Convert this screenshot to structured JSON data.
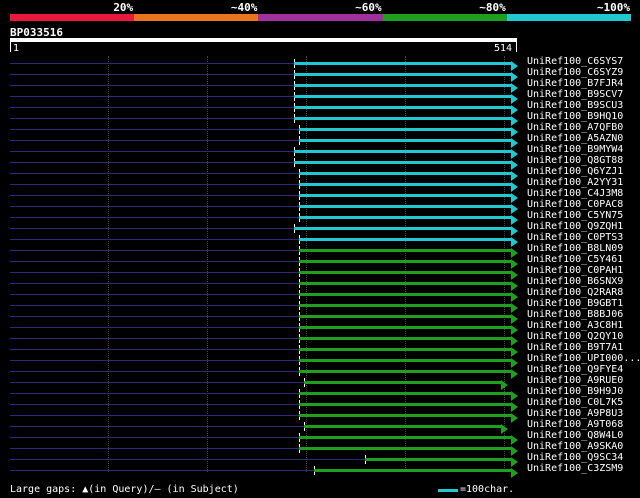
{
  "scale": {
    "segments": [
      {
        "label": "20%",
        "color": "#e8193c"
      },
      {
        "label": "~40%",
        "color": "#e8741e"
      },
      {
        "label": "~60%",
        "color": "#a0309c"
      },
      {
        "label": "~80%",
        "color": "#1ea01e"
      },
      {
        "label": "~100%",
        "color": "#22c8d0"
      }
    ]
  },
  "query": {
    "id": "BP033516",
    "start": "1",
    "end": "514",
    "length": 514
  },
  "hits": [
    {
      "label": "UniRef100_C6SYS7",
      "start": 0.56,
      "end": 1.0,
      "color": "#22c8d0"
    },
    {
      "label": "UniRef100_C6SYZ9",
      "start": 0.56,
      "end": 1.0,
      "color": "#22c8d0"
    },
    {
      "label": "UniRef100_B7FJR4",
      "start": 0.56,
      "end": 1.0,
      "color": "#22c8d0"
    },
    {
      "label": "UniRef100_B9SCV7",
      "start": 0.56,
      "end": 1.0,
      "color": "#22c8d0"
    },
    {
      "label": "UniRef100_B9SCU3",
      "start": 0.56,
      "end": 1.0,
      "color": "#22c8d0"
    },
    {
      "label": "UniRef100_B9HQ10",
      "start": 0.56,
      "end": 1.0,
      "color": "#22c8d0"
    },
    {
      "label": "UniRef100_A7QFB0",
      "start": 0.57,
      "end": 1.0,
      "color": "#22c8d0"
    },
    {
      "label": "UniRef100_A5AZN0",
      "start": 0.57,
      "end": 1.0,
      "color": "#22c8d0"
    },
    {
      "label": "UniRef100_B9MYW4",
      "start": 0.56,
      "end": 1.0,
      "color": "#22c8d0"
    },
    {
      "label": "UniRef100_Q8GT88",
      "start": 0.56,
      "end": 1.0,
      "color": "#22c8d0"
    },
    {
      "label": "UniRef100_Q6YZJ1",
      "start": 0.57,
      "end": 1.0,
      "color": "#22c8d0"
    },
    {
      "label": "UniRef100_A2YY31",
      "start": 0.57,
      "end": 1.0,
      "color": "#22c8d0"
    },
    {
      "label": "UniRef100_C4J3M8",
      "start": 0.57,
      "end": 1.0,
      "color": "#22c8d0"
    },
    {
      "label": "UniRef100_C0PAC8",
      "start": 0.57,
      "end": 1.0,
      "color": "#22c8d0"
    },
    {
      "label": "UniRef100_C5YN75",
      "start": 0.57,
      "end": 1.0,
      "color": "#22c8d0"
    },
    {
      "label": "UniRef100_Q9ZQH1",
      "start": 0.56,
      "end": 1.0,
      "color": "#22c8d0"
    },
    {
      "label": "UniRef100_C0PTS3",
      "start": 0.57,
      "end": 1.0,
      "color": "#22c8d0"
    },
    {
      "label": "UniRef100_B8LN09",
      "start": 0.57,
      "end": 1.0,
      "color": "#1ea01e"
    },
    {
      "label": "UniRef100_C5Y461",
      "start": 0.57,
      "end": 1.0,
      "color": "#1ea01e"
    },
    {
      "label": "UniRef100_C0PAH1",
      "start": 0.57,
      "end": 1.0,
      "color": "#1ea01e"
    },
    {
      "label": "UniRef100_B6SNX9",
      "start": 0.57,
      "end": 1.0,
      "color": "#1ea01e"
    },
    {
      "label": "UniRef100_Q2RAR8",
      "start": 0.57,
      "end": 1.0,
      "color": "#1ea01e"
    },
    {
      "label": "UniRef100_B9GBT1",
      "start": 0.57,
      "end": 1.0,
      "color": "#1ea01e"
    },
    {
      "label": "UniRef100_B8BJ06",
      "start": 0.57,
      "end": 1.0,
      "color": "#1ea01e"
    },
    {
      "label": "UniRef100_A3C8H1",
      "start": 0.57,
      "end": 1.0,
      "color": "#1ea01e"
    },
    {
      "label": "UniRef100_Q2QY10",
      "start": 0.57,
      "end": 1.0,
      "color": "#1ea01e"
    },
    {
      "label": "UniRef100_B9T7A1",
      "start": 0.57,
      "end": 1.0,
      "color": "#1ea01e"
    },
    {
      "label": "UniRef100_UPI000...",
      "start": 0.57,
      "end": 1.0,
      "color": "#1ea01e"
    },
    {
      "label": "UniRef100_Q9FYE4",
      "start": 0.57,
      "end": 1.0,
      "color": "#1ea01e"
    },
    {
      "label": "UniRef100_A9RUE0",
      "start": 0.58,
      "end": 0.98,
      "color": "#1ea01e"
    },
    {
      "label": "UniRef100_B9H9J0",
      "start": 0.57,
      "end": 1.0,
      "color": "#1ea01e"
    },
    {
      "label": "UniRef100_C0L7K5",
      "start": 0.57,
      "end": 1.0,
      "color": "#1ea01e"
    },
    {
      "label": "UniRef100_A9P8U3",
      "start": 0.57,
      "end": 1.0,
      "color": "#1ea01e"
    },
    {
      "label": "UniRef100_A9T068",
      "start": 0.58,
      "end": 0.98,
      "color": "#1ea01e"
    },
    {
      "label": "UniRef100_Q8W4L0",
      "start": 0.57,
      "end": 1.0,
      "color": "#1ea01e"
    },
    {
      "label": "UniRef100_A9SKA0",
      "start": 0.57,
      "end": 1.0,
      "color": "#1ea01e"
    },
    {
      "label": "UniRef100_Q9SC34",
      "start": 0.7,
      "end": 1.0,
      "color": "#1ea01e"
    },
    {
      "label": "UniRef100_C3ZSM9",
      "start": 0.6,
      "end": 1.0,
      "color": "#1ea01e"
    }
  ],
  "footer": {
    "gaps_text": "Large gaps: ▲(in Query)/— (in Subject)",
    "legend_text": "=100char."
  }
}
